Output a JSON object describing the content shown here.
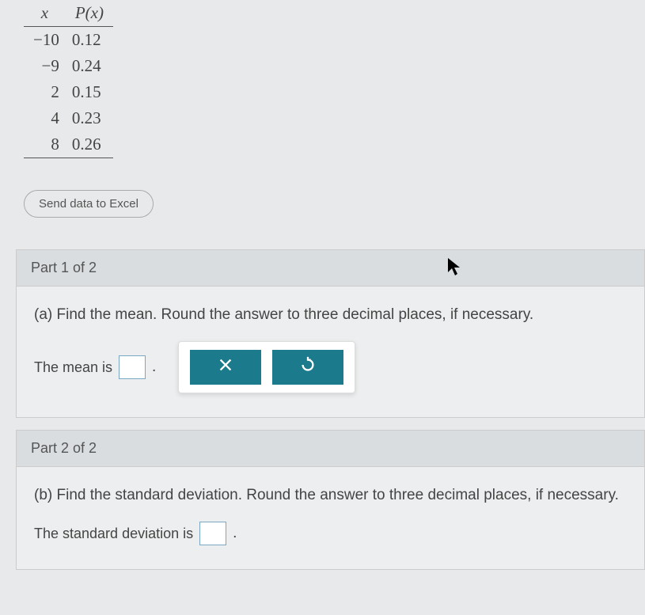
{
  "table": {
    "headers": {
      "x": "x",
      "p": "P(x)"
    },
    "rows": [
      {
        "x": "−10",
        "p": "0.12"
      },
      {
        "x": "−9",
        "p": "0.24"
      },
      {
        "x": "2",
        "p": "0.15"
      },
      {
        "x": "4",
        "p": "0.23"
      },
      {
        "x": "8",
        "p": "0.26"
      }
    ]
  },
  "send_button": "Send data to Excel",
  "part1": {
    "header": "Part 1 of 2",
    "question": "(a) Find the mean. Round the answer to three decimal places, if necessary.",
    "answer_label": "The mean is",
    "answer_value": ""
  },
  "part2": {
    "header": "Part 2 of 2",
    "question": "(b) Find the standard deviation. Round the answer to three decimal places, if necessary.",
    "answer_label": "The standard deviation is",
    "answer_value": ""
  }
}
